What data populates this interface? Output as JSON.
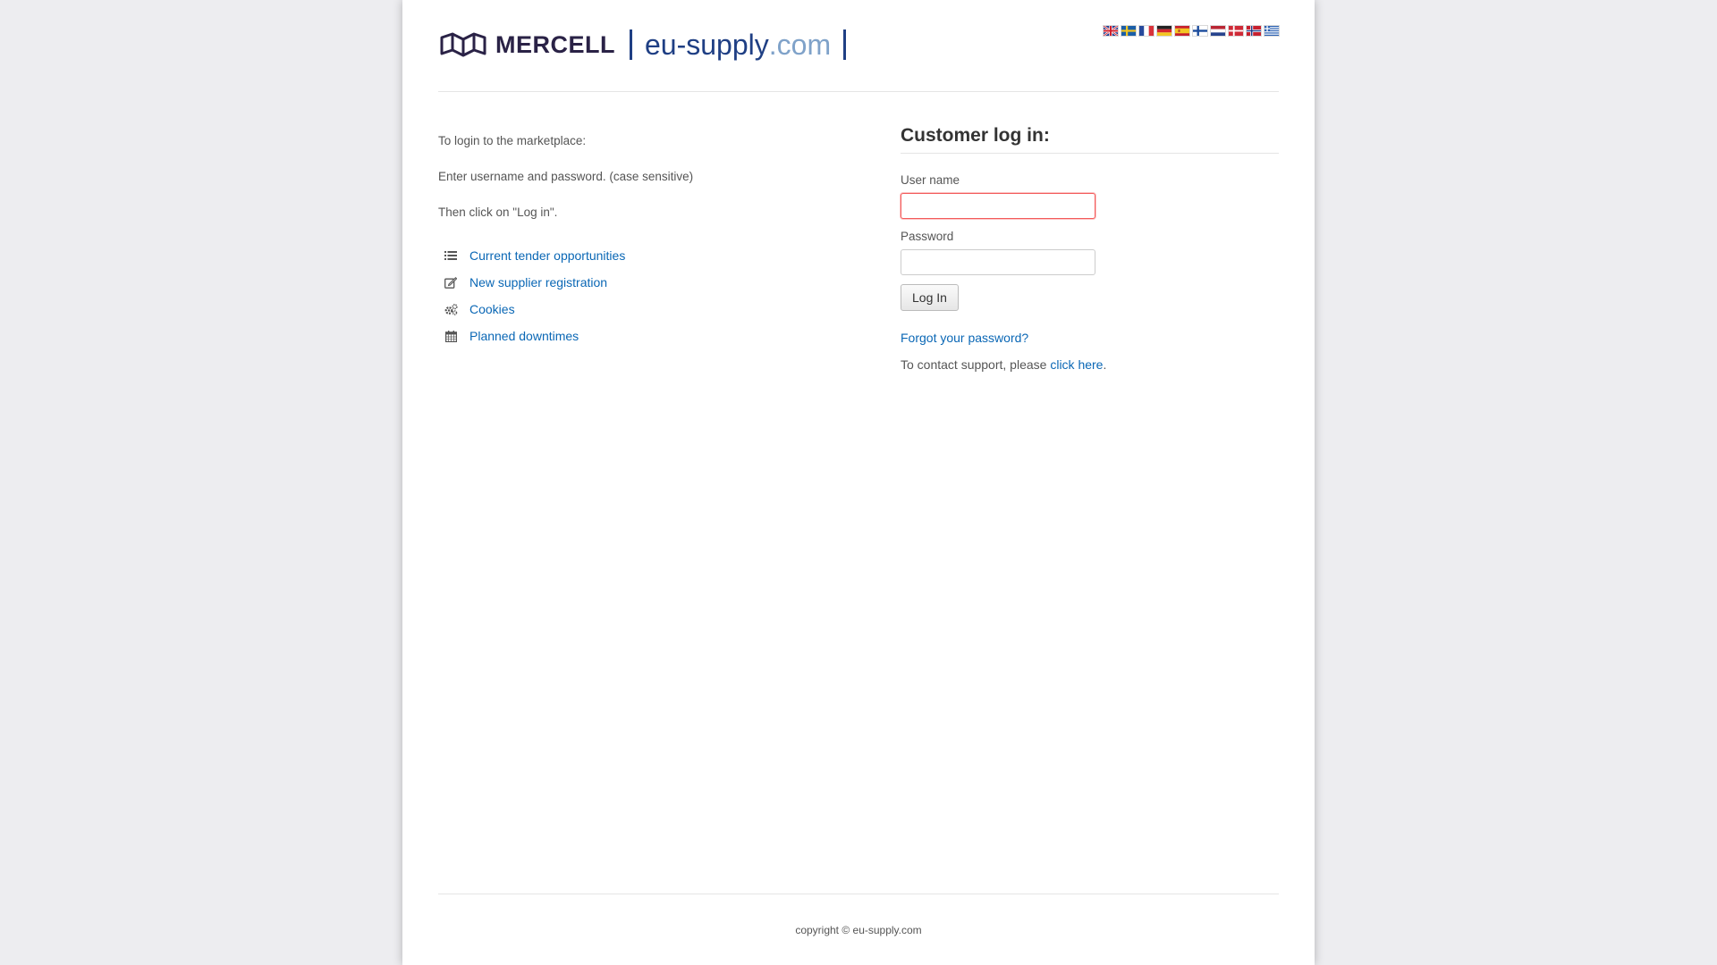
{
  "header": {
    "logo_text": "MERCELL",
    "site_name_main": "eu-supply",
    "site_name_tld": ".com",
    "languages": [
      {
        "code": "en",
        "icon": "uk-flag-icon"
      },
      {
        "code": "sv",
        "icon": "sweden-flag-icon"
      },
      {
        "code": "fr",
        "icon": "france-flag-icon"
      },
      {
        "code": "de",
        "icon": "germany-flag-icon"
      },
      {
        "code": "es",
        "icon": "spain-flag-icon"
      },
      {
        "code": "fi",
        "icon": "finland-flag-icon"
      },
      {
        "code": "nl",
        "icon": "netherlands-flag-icon"
      },
      {
        "code": "da",
        "icon": "denmark-flag-icon"
      },
      {
        "code": "no",
        "icon": "norway-flag-icon"
      },
      {
        "code": "el",
        "icon": "greece-flag-icon"
      }
    ]
  },
  "intro": {
    "line1": "To login to the marketplace:",
    "line2": "Enter username and password. (case sensitive)",
    "line3": "Then click on \"Log in\"."
  },
  "links": [
    {
      "label": "Current tender opportunities",
      "icon": "list-icon"
    },
    {
      "label": "New supplier registration",
      "icon": "edit-icon"
    },
    {
      "label": "Cookies",
      "icon": "gears-icon"
    },
    {
      "label": "Planned downtimes",
      "icon": "calendar-icon"
    }
  ],
  "login": {
    "title": "Customer log in:",
    "username_label": "User name",
    "username_value": "",
    "password_label": "Password",
    "password_value": "",
    "submit_label": "Log In",
    "forgot_label": "Forgot your password?",
    "support_text": "To contact support, please ",
    "support_link": "click here",
    "support_end": "."
  },
  "footer": {
    "copyright": "copyright © eu-supply.com"
  },
  "colors": {
    "link": "#0a67b5",
    "brand_dark": "#2a2246",
    "brand_blue": "#1f3f84",
    "brand_light": "#7fa2c9",
    "focus_border": "#f35a5a"
  }
}
